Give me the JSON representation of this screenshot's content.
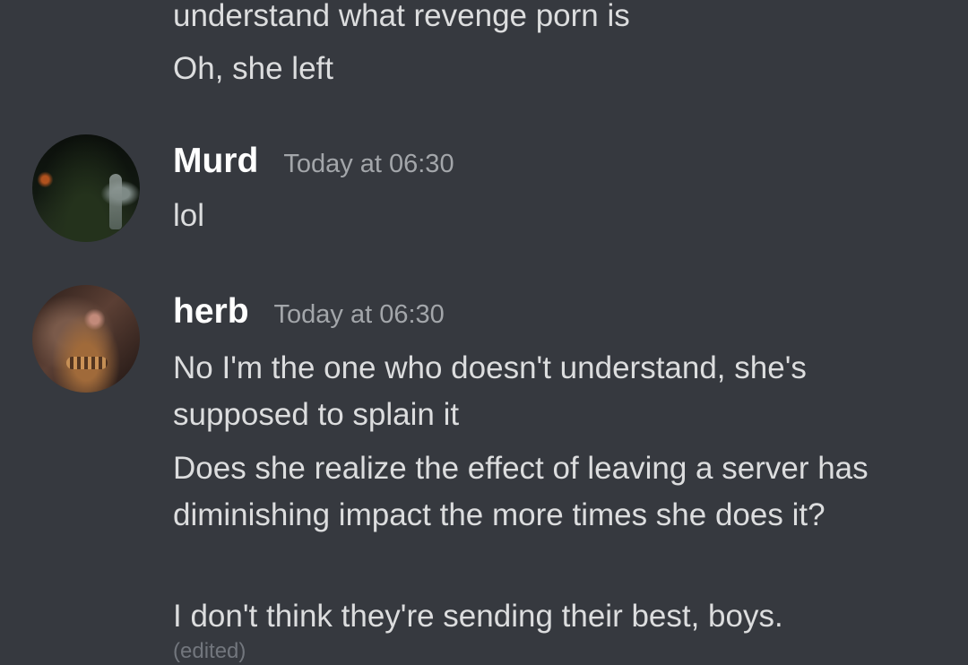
{
  "messages": {
    "prev_line_1": "understand what revenge porn is",
    "prev_line_2": "Oh, she left",
    "murd": {
      "username": "Murd",
      "timestamp": "Today at 06:30",
      "text_1": "lol"
    },
    "herb": {
      "username": "herb",
      "timestamp": "Today at 06:30",
      "text_1": "No I'm the one who doesn't understand, she's supposed to splain it",
      "text_2": "Does she realize the effect of leaving a server has diminishing impact the more times she does it?",
      "text_3": "I don't think they're sending their best, boys.",
      "edited": "(edited)"
    }
  }
}
